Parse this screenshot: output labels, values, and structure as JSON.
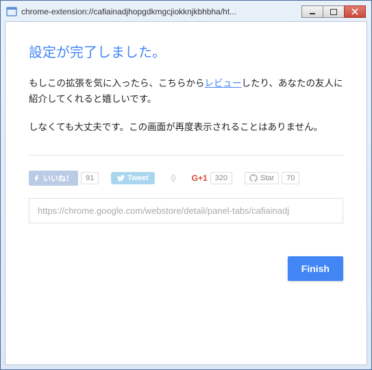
{
  "window": {
    "title": "chrome-extension://cafiainadjhopgdkmgcjiokknjkbhbha/ht..."
  },
  "page": {
    "heading": "設定が完了しました。",
    "para1_pre": "もしこの拡張を気に入ったら、こちらから",
    "para1_link": "レビュー",
    "para1_post": "したり、あなたの友人に紹介してくれると嬉しいです。",
    "para2": "しなくても大丈夫です。この画面が再度表示されることはありません。"
  },
  "social": {
    "fb_label": "いいね！",
    "fb_count": "91",
    "tw_label": "Tweet",
    "gp_label": "G+1",
    "gp_count": "320",
    "gh_label": "Star",
    "gh_count": "70"
  },
  "url_input": "https://chrome.google.com/webstore/detail/panel-tabs/cafiainadj",
  "finish_label": "Finish"
}
